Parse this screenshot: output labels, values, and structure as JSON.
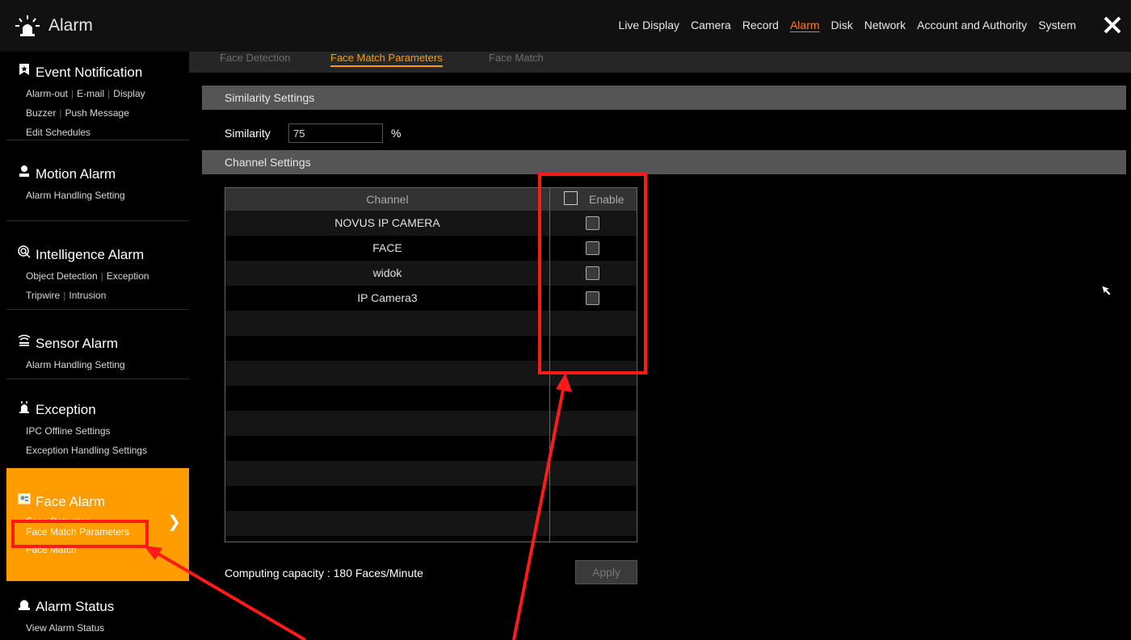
{
  "app": {
    "title": "Alarm"
  },
  "nav": {
    "items": [
      "Live Display",
      "Camera",
      "Record",
      "Alarm",
      "Disk",
      "Network",
      "Account and Authority",
      "System"
    ],
    "active": "Alarm"
  },
  "sidebar": {
    "event": {
      "title": "Event Notification",
      "links": [
        "Alarm-out",
        "E-mail",
        "Display",
        "Buzzer",
        "Push Message",
        "Edit Schedules"
      ]
    },
    "motion": {
      "title": "Motion Alarm",
      "links": [
        "Alarm Handling Setting"
      ]
    },
    "intel": {
      "title": "Intelligence Alarm",
      "links": [
        "Object Detection",
        "Exception",
        "Tripwire",
        "Intrusion"
      ]
    },
    "sensor": {
      "title": "Sensor Alarm",
      "links": [
        "Alarm Handling Setting"
      ]
    },
    "exception": {
      "title": "Exception",
      "links": [
        "IPC Offline Settings",
        "Exception Handling Settings"
      ]
    },
    "face": {
      "title": "Face Alarm",
      "links": [
        "Face Detection",
        "Face Match Parameters",
        "Face Match"
      ]
    },
    "status": {
      "title": "Alarm Status",
      "links": [
        "View Alarm Status"
      ]
    }
  },
  "tabs": [
    "Face Detection",
    "Face Match Parameters",
    "Face Match"
  ],
  "similarity": {
    "section_title": "Similarity Settings",
    "label": "Similarity",
    "value": "75",
    "unit": "%"
  },
  "channels": {
    "section_title": "Channel Settings",
    "col_channel": "Channel",
    "col_enable": "Enable",
    "rows": [
      "NOVUS IP CAMERA",
      "FACE",
      "widok",
      "IP Camera3"
    ]
  },
  "capacity_text": "Computing capacity : 180 Faces/Minute",
  "apply_label": "Apply",
  "colors": {
    "accent": "#ff9c00",
    "nav_active": "#ff7a1a",
    "annotation": "#ff1a1a"
  }
}
